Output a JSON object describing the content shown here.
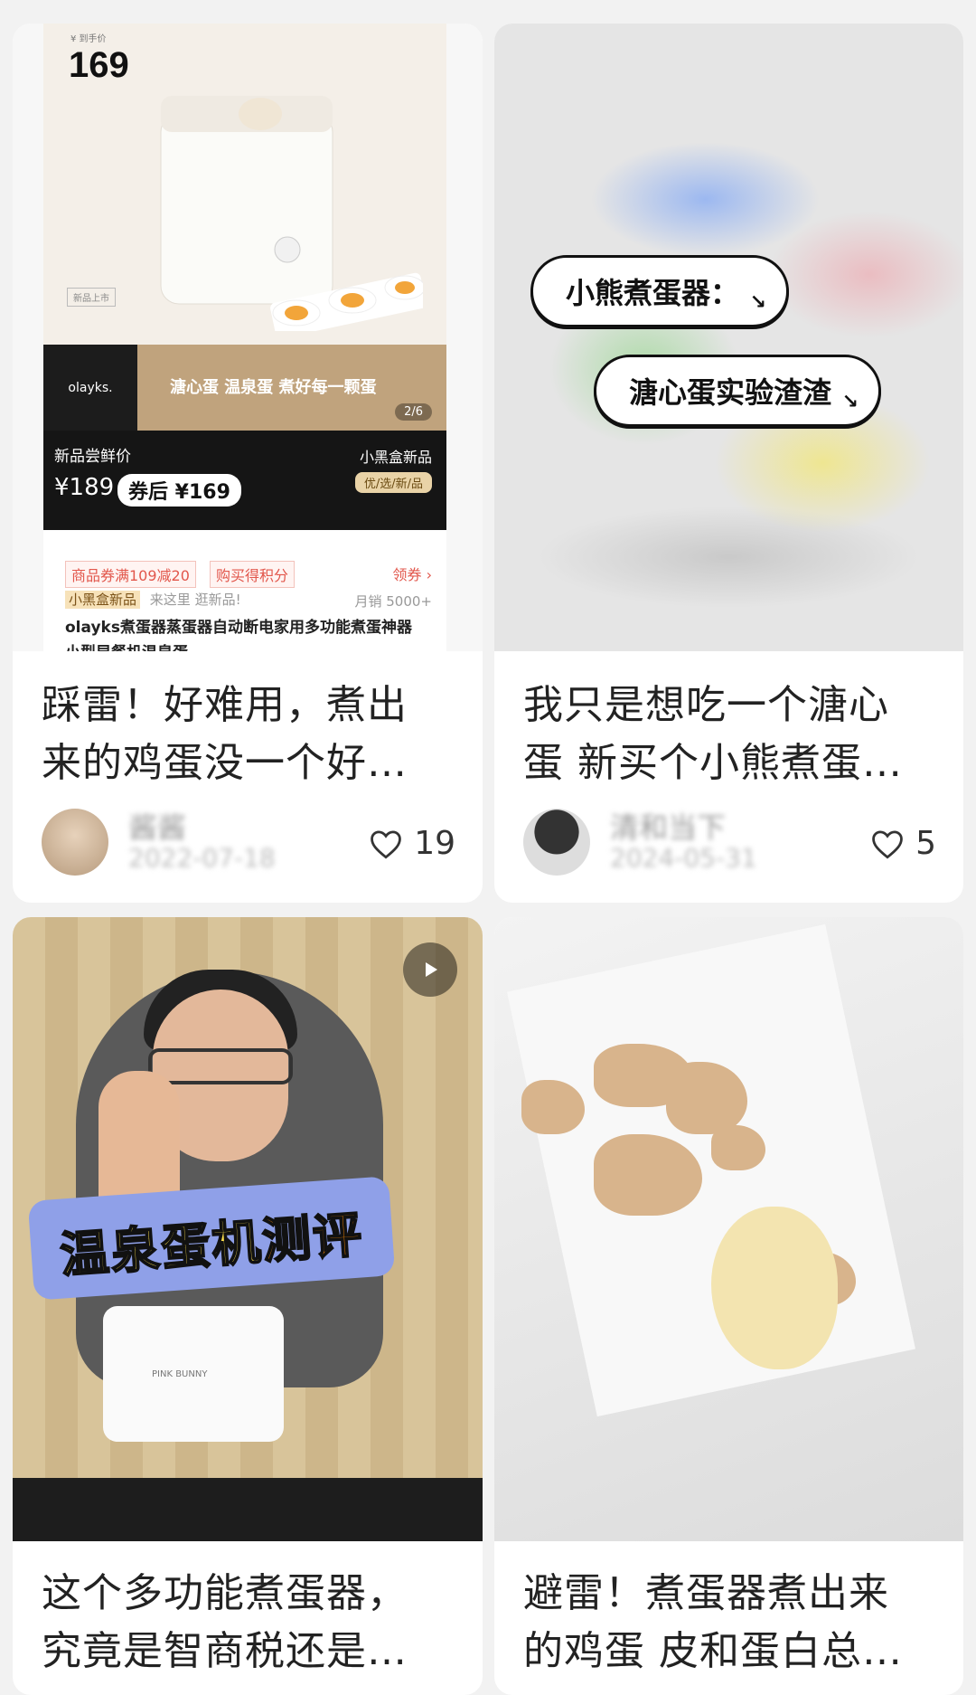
{
  "cards": [
    {
      "title_line1": "踩雷！好难用，煮出",
      "title_line2": "来的鸡蛋没一个好…",
      "author": "酱酱",
      "date": "2022-07-18",
      "likes": "19",
      "image": {
        "price_label": "¥ 到手价",
        "price": "169",
        "logo": "olayks.",
        "caption": "溏心蛋 温泉蛋 煮好每一颗蛋",
        "page": "2/6",
        "new_tag": "新品上市",
        "new_label": "新品尝鲜价",
        "orig_price": "¥189",
        "coupon_price": "券后 ¥169",
        "brand": "小黑盒新品",
        "brand_tag": "优/选/新/品",
        "coupon1": "商品券满109减20",
        "coupon2": "购买得积分",
        "get_coupon": "领券 ›",
        "shop": "小黑盒新品",
        "shop_slogan": "来这里 逛新品!",
        "monthly_sales": "月销 5000+",
        "product_name": "olayks煮蛋器蒸蛋器自动断电家用多功能煮蛋神器小型早餐机温泉蛋"
      }
    },
    {
      "title_line1": "我只是想吃一个溏心",
      "title_line2": "蛋 新买个小熊煮蛋…",
      "author": "清和当下",
      "date": "2024-05-31",
      "likes": "5",
      "image": {
        "bubble1": "小熊煮蛋器：",
        "bubble2": "溏心蛋实验渣渣"
      }
    },
    {
      "title_line1": "这个多功能煮蛋器，",
      "title_line2": "究竟是智商税还是…",
      "image": {
        "banner_a": "温泉蛋机",
        "banner_b": "测评",
        "device_brand": "PINK BUNNY"
      }
    },
    {
      "title_line1": "避雷！煮蛋器煮出来",
      "title_line2": "的鸡蛋 皮和蛋白总…"
    }
  ],
  "icons": {
    "like": "heart-outline-icon",
    "play": "play-icon"
  }
}
